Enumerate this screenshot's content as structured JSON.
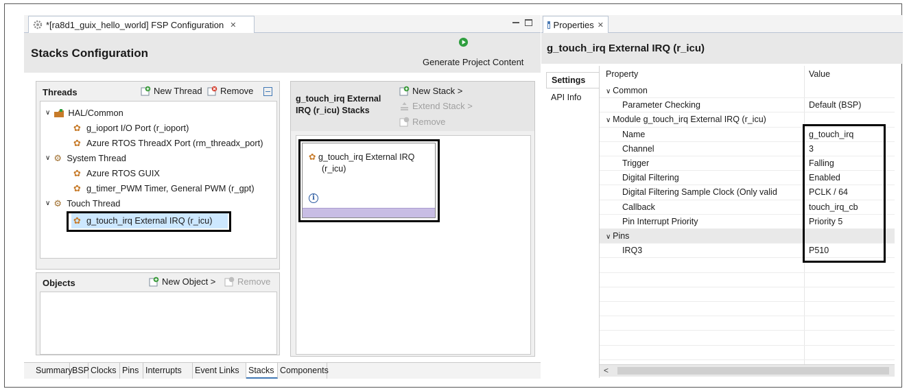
{
  "editor": {
    "tab_title": "*[ra8d1_guix_hello_world] FSP Configuration",
    "tab_close": "✕",
    "heading": "Stacks Configuration",
    "generate_label": "Generate Project Content"
  },
  "threads": {
    "title": "Threads",
    "new_thread": "New Thread",
    "remove": "Remove",
    "items": [
      {
        "label": "HAL/Common"
      },
      {
        "label": "g_ioport I/O Port (r_ioport)"
      },
      {
        "label": "Azure RTOS ThreadX Port (rm_threadx_port)"
      },
      {
        "label": "System Thread"
      },
      {
        "label": "Azure RTOS GUIX"
      },
      {
        "label": "g_timer_PWM Timer, General PWM (r_gpt)"
      },
      {
        "label": "Touch Thread"
      },
      {
        "label": "g_touch_irq External IRQ (r_icu)"
      }
    ]
  },
  "objects": {
    "title": "Objects",
    "new_object": "New Object >",
    "remove": "Remove"
  },
  "stacks": {
    "title_line1": "g_touch_irq External",
    "title_line2": "IRQ (r_icu) Stacks",
    "new_stack": "New Stack >",
    "extend_stack": "Extend Stack >",
    "remove": "Remove",
    "module_line1": "g_touch_irq External IRQ",
    "module_line2": "(r_icu)",
    "info_glyph": "i"
  },
  "bottom_tabs": [
    "Summary",
    "BSP",
    "Clocks",
    "Pins",
    "Interrupts",
    "Event Links",
    "Stacks",
    "Components"
  ],
  "bottom_active": "Stacks",
  "properties": {
    "tab_title": "Properties",
    "tab_close": "✕",
    "heading": "g_touch_irq External IRQ (r_icu)",
    "side_tabs": [
      "Settings",
      "API Info"
    ],
    "col_property": "Property",
    "col_value": "Value",
    "rows": [
      {
        "property": "Common",
        "value": "",
        "kind": "group"
      },
      {
        "property": "Parameter Checking",
        "value": "Default (BSP)",
        "kind": "item"
      },
      {
        "property": "Module g_touch_irq External IRQ (r_icu)",
        "value": "",
        "kind": "group"
      },
      {
        "property": "Name",
        "value": "g_touch_irq",
        "kind": "item"
      },
      {
        "property": "Channel",
        "value": "3",
        "kind": "item"
      },
      {
        "property": "Trigger",
        "value": "Falling",
        "kind": "item"
      },
      {
        "property": "Digital Filtering",
        "value": "Enabled",
        "kind": "item"
      },
      {
        "property": "Digital Filtering Sample Clock (Only valid",
        "value": "PCLK / 64",
        "kind": "item"
      },
      {
        "property": "Callback",
        "value": "touch_irq_cb",
        "kind": "item"
      },
      {
        "property": "Pin Interrupt Priority",
        "value": "Priority 5",
        "kind": "item"
      },
      {
        "property": "Pins",
        "value": "",
        "kind": "pins"
      },
      {
        "property": "IRQ3",
        "value": "P510",
        "kind": "item"
      }
    ],
    "scroll_left": "<"
  },
  "colors": {
    "tree_selected": "#cde8ff",
    "module_bar": "#c8bde4",
    "header_bar": "#e8e8e8"
  }
}
